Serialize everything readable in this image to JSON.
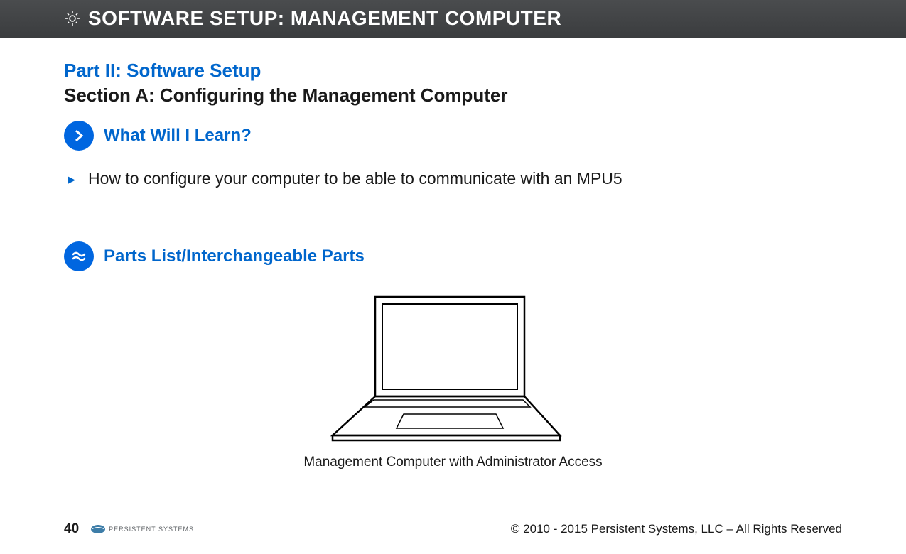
{
  "header": {
    "title": "SOFTWARE SETUP:  MANAGEMENT COMPUTER"
  },
  "content": {
    "part_title": "Part II:  Software Setup",
    "section_title": "Section A:  Configuring the Management Computer",
    "learn": {
      "label": "What Will I Learn?",
      "items": [
        "How to configure your computer to be able to communicate with an MPU5"
      ]
    },
    "parts": {
      "label": "Parts List/Interchangeable Parts",
      "caption": "Management Computer with Administrator Access"
    }
  },
  "footer": {
    "page": "40",
    "logo_text": "PERSISTENT SYSTEMS",
    "copyright": "© 2010 - 2015 Persistent Systems, LLC – All Rights Reserved"
  }
}
